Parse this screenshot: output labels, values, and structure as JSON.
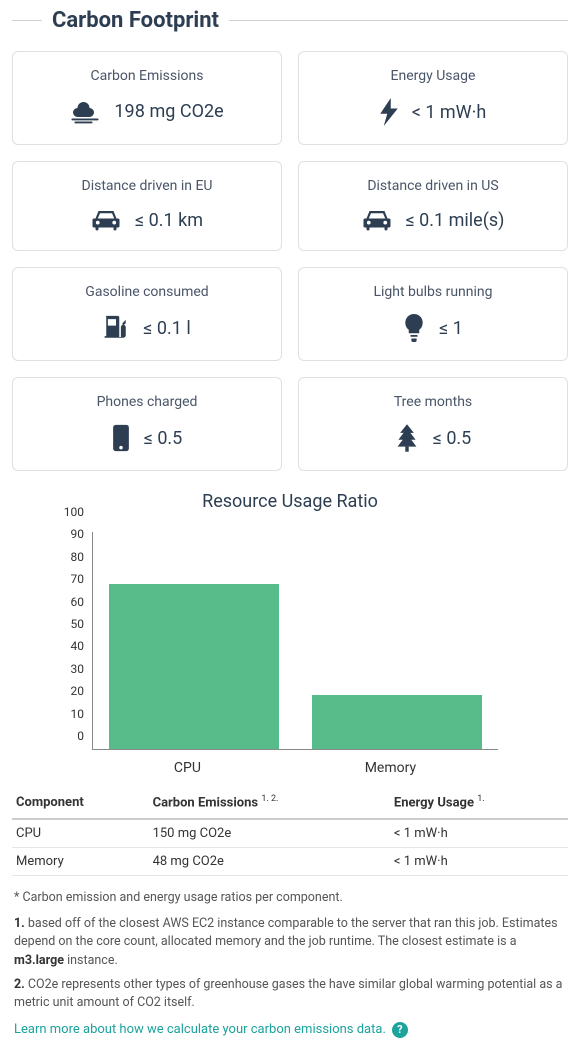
{
  "header": {
    "title": "Carbon Footprint"
  },
  "cards": [
    {
      "title": "Carbon Emissions",
      "value": "198 mg CO2e",
      "icon": "smog-icon"
    },
    {
      "title": "Energy Usage",
      "value": "< 1 mW·h",
      "icon": "bolt-icon"
    },
    {
      "title": "Distance driven in EU",
      "value": "≤ 0.1 km",
      "icon": "car-icon"
    },
    {
      "title": "Distance driven in US",
      "value": "≤ 0.1 mile(s)",
      "icon": "car-icon"
    },
    {
      "title": "Gasoline consumed",
      "value": "≤ 0.1 l",
      "icon": "gas-pump-icon"
    },
    {
      "title": "Light bulbs running",
      "value": "≤ 1",
      "icon": "lightbulb-icon"
    },
    {
      "title": "Phones charged",
      "value": "≤ 0.5",
      "icon": "phone-icon"
    },
    {
      "title": "Tree months",
      "value": "≤ 0.5",
      "icon": "tree-icon"
    }
  ],
  "chart_title": "Resource Usage Ratio",
  "chart_data": {
    "type": "bar",
    "categories": [
      "CPU",
      "Memory"
    ],
    "values": [
      76,
      25
    ],
    "ylim": [
      0,
      100
    ],
    "yticks": [
      0,
      10,
      20,
      30,
      40,
      50,
      60,
      70,
      80,
      90,
      100
    ],
    "title": "Resource Usage Ratio",
    "xlabel": "",
    "ylabel": "",
    "bar_color": "#57bb8a"
  },
  "table": {
    "headers": {
      "component": "Component",
      "carbon": "Carbon Emissions",
      "carbon_sup": "1. 2.",
      "energy": "Energy Usage",
      "energy_sup": "1."
    },
    "rows": [
      {
        "component": "CPU",
        "carbon": "150 mg CO2e",
        "energy": "< 1 mW·h"
      },
      {
        "component": "Memory",
        "carbon": "48 mg CO2e",
        "energy": "< 1 mW·h"
      }
    ]
  },
  "caption": "* Carbon emission and energy usage ratios per component.",
  "footnotes": {
    "f1_prefix": "1.",
    "f1_a": " based off of the closest AWS EC2 instance comparable to the server that ran this job. Estimates depend on the core count, allocated memory and the job runtime. The closest estimate is a ",
    "f1_bold": "m3.large",
    "f1_b": " instance.",
    "f2_prefix": "2.",
    "f2": " CO2e represents other types of greenhouse gases the have similar global warming potential as a metric unit amount of CO2 itself."
  },
  "learn_more": "Learn more about how we calculate your carbon emissions data."
}
